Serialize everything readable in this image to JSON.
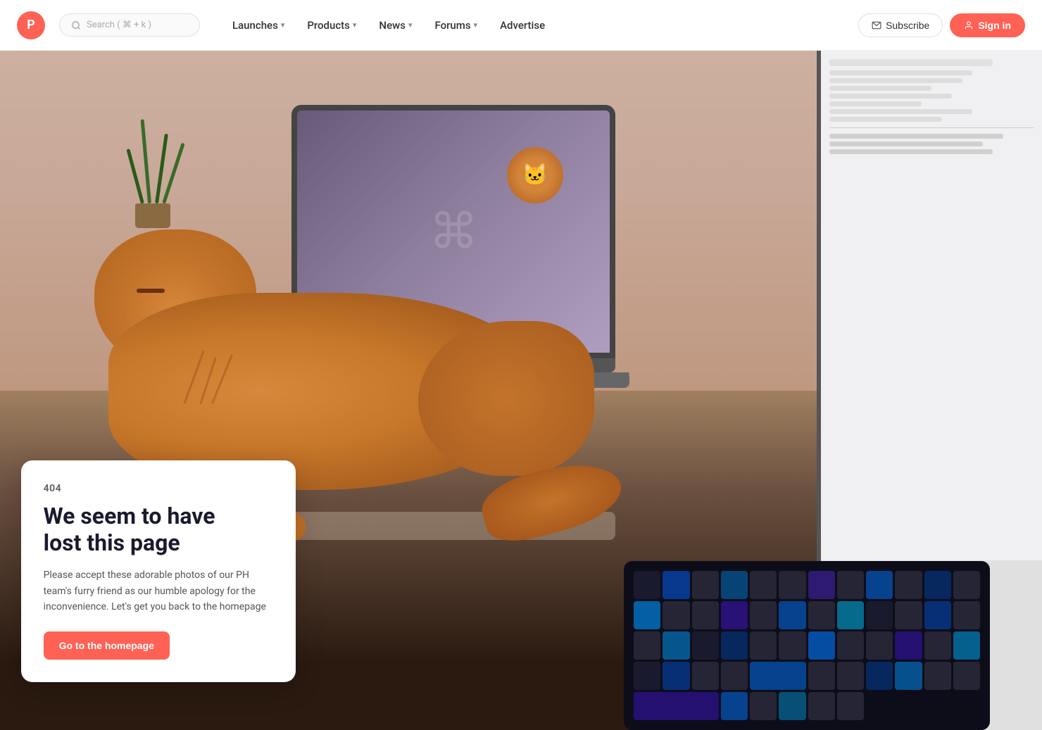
{
  "navbar": {
    "logo_letter": "P",
    "search_placeholder": "Search ( ⌘ + k )",
    "nav_items": [
      {
        "id": "launches",
        "label": "Launches",
        "has_dropdown": true
      },
      {
        "id": "products",
        "label": "Products",
        "has_dropdown": true
      },
      {
        "id": "news",
        "label": "News",
        "has_dropdown": true
      },
      {
        "id": "forums",
        "label": "Forums",
        "has_dropdown": true
      },
      {
        "id": "advertise",
        "label": "Advertise",
        "has_dropdown": false
      }
    ],
    "subscribe_label": "Subscribe",
    "signin_label": "Sign in"
  },
  "error": {
    "code": "404",
    "title_line1": "We seem to have",
    "title_line2": "lost this page",
    "description": "Please accept these adorable photos of our PH team's furry friend as our humble apology for the inconvenience. Let's get you back to the homepage",
    "cta_label": "Go to the homepage"
  },
  "colors": {
    "brand": "#ff6154",
    "dark": "#1a1a2e",
    "text_muted": "#666666",
    "text_body": "#555555"
  }
}
